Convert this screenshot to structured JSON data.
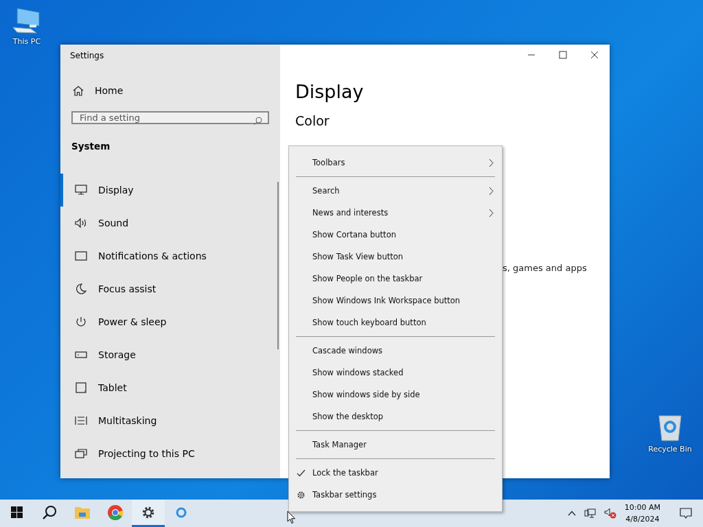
{
  "desktop_icons": [
    {
      "label": "This PC",
      "kind": "pc"
    },
    {
      "label": "Recycle Bin",
      "kind": "bin"
    }
  ],
  "settings_window": {
    "title": "Settings",
    "sidebar": {
      "home": "Home",
      "search": {
        "placeholder": "Find a setting"
      },
      "section": "System",
      "items": [
        {
          "label": "Display",
          "kind": "display",
          "selected": true
        },
        {
          "label": "Sound",
          "kind": "sound",
          "selected": false
        },
        {
          "label": "Notifications & actions",
          "kind": "notifications",
          "selected": false
        },
        {
          "label": "Focus assist",
          "kind": "focus",
          "selected": false
        },
        {
          "label": "Power & sleep",
          "kind": "power",
          "selected": false
        },
        {
          "label": "Storage",
          "kind": "storage",
          "selected": false
        },
        {
          "label": "Tablet",
          "kind": "tablet",
          "selected": false
        },
        {
          "label": "Multitasking",
          "kind": "multitasking",
          "selected": false
        },
        {
          "label": "Projecting to this PC",
          "kind": "projecting",
          "selected": false
        }
      ]
    },
    "content": {
      "heading": "Display",
      "subheading": "Color",
      "visible_text": "s, games and apps"
    }
  },
  "context_menu": {
    "items": [
      {
        "kind": "item",
        "label": "Toolbars",
        "submenu": true,
        "checked": false
      },
      {
        "kind": "separator"
      },
      {
        "kind": "item",
        "label": "Search",
        "submenu": true,
        "checked": false
      },
      {
        "kind": "item",
        "label": "News and interests",
        "submenu": true,
        "checked": false
      },
      {
        "kind": "item",
        "label": "Show Cortana button",
        "submenu": false,
        "checked": false
      },
      {
        "kind": "item",
        "label": "Show Task View button",
        "submenu": false,
        "checked": false
      },
      {
        "kind": "item",
        "label": "Show People on the taskbar",
        "submenu": false,
        "checked": false
      },
      {
        "kind": "item",
        "label": "Show Windows Ink Workspace button",
        "submenu": false,
        "checked": false
      },
      {
        "kind": "item",
        "label": "Show touch keyboard button",
        "submenu": false,
        "checked": false
      },
      {
        "kind": "separator"
      },
      {
        "kind": "item",
        "label": "Cascade windows",
        "submenu": false,
        "checked": false
      },
      {
        "kind": "item",
        "label": "Show windows stacked",
        "submenu": false,
        "checked": false
      },
      {
        "kind": "item",
        "label": "Show windows side by side",
        "submenu": false,
        "checked": false
      },
      {
        "kind": "item",
        "label": "Show the desktop",
        "submenu": false,
        "checked": false
      },
      {
        "kind": "separator"
      },
      {
        "kind": "item",
        "label": "Task Manager",
        "submenu": false,
        "checked": false
      },
      {
        "kind": "separator"
      },
      {
        "kind": "item",
        "label": "Lock the taskbar",
        "submenu": false,
        "checked": true
      },
      {
        "kind": "settings",
        "label": "Taskbar settings",
        "submenu": false,
        "checked": false
      }
    ]
  },
  "taskbar": {
    "apps": [
      {
        "kind": "start",
        "selected": false
      },
      {
        "kind": "search",
        "selected": false
      },
      {
        "kind": "explorer",
        "selected": false
      },
      {
        "kind": "chrome",
        "selected": false
      },
      {
        "kind": "settings",
        "selected": true
      },
      {
        "kind": "cortana",
        "selected": false
      }
    ],
    "time": "10:00 AM",
    "date": "4/8/2024"
  }
}
